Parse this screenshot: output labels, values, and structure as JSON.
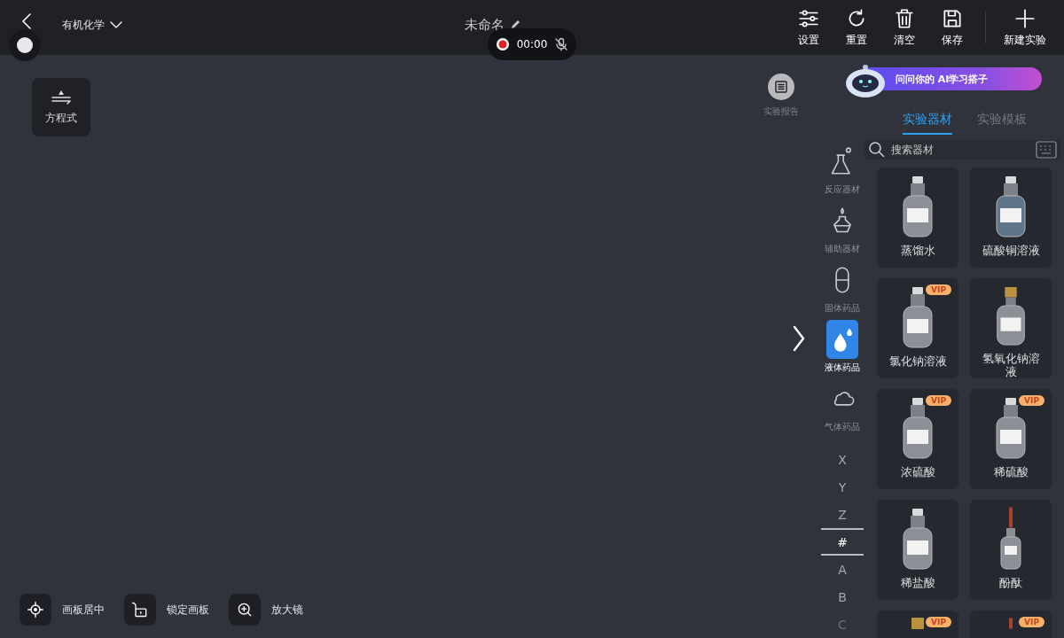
{
  "top_bar": {
    "subject": "有机化学",
    "title": "未命名",
    "recording": {
      "time": "00:00",
      "mic_muted": true
    },
    "tools": [
      {
        "kind": "settings",
        "label": "设置"
      },
      {
        "kind": "reset",
        "label": "重置"
      },
      {
        "kind": "clear",
        "label": "清空"
      },
      {
        "kind": "save",
        "label": "保存"
      },
      {
        "kind": "new",
        "label": "新建实验"
      }
    ]
  },
  "canvas": {
    "equation_button": "方程式",
    "report_button": "实验报告",
    "bottom_tools": [
      {
        "kind": "center",
        "label": "画板居中"
      },
      {
        "kind": "lock",
        "label": "锁定画板"
      },
      {
        "kind": "zoom",
        "label": "放大镜"
      }
    ]
  },
  "panel": {
    "banner": "问问你的 AI学习搭子",
    "tabs": [
      {
        "label": "实验器材",
        "selected": true
      },
      {
        "label": "实验模板",
        "selected": false
      }
    ],
    "search": {
      "placeholder": "搜索器材"
    },
    "categories": [
      {
        "kind": "flask",
        "label": "反应器材",
        "selected": false
      },
      {
        "kind": "burner",
        "label": "辅助器材",
        "selected": false
      },
      {
        "kind": "capsule",
        "label": "固体药品",
        "selected": false
      },
      {
        "kind": "drop",
        "label": "液体药品",
        "selected": true
      },
      {
        "kind": "cloud",
        "label": "气体药品",
        "selected": false
      }
    ],
    "index_letters": [
      {
        "label": "X",
        "selected": false
      },
      {
        "label": "Y",
        "selected": false
      },
      {
        "label": "Z",
        "selected": false
      },
      {
        "label": "#",
        "selected": true
      },
      {
        "label": "A",
        "selected": false
      },
      {
        "label": "B",
        "selected": false
      },
      {
        "label": "C",
        "selected": false
      }
    ],
    "items": [
      {
        "name": "蒸馏水",
        "kind": "clear"
      },
      {
        "name": "硫酸铜溶液",
        "kind": "blue"
      },
      {
        "name": "氯化钠溶液",
        "kind": "clear",
        "badge": "VIP"
      },
      {
        "name": "氢氧化钠溶液",
        "kind": "gold"
      },
      {
        "name": "浓硫酸",
        "kind": "clear",
        "badge": "VIP"
      },
      {
        "name": "稀硫酸",
        "kind": "clear",
        "badge": "VIP"
      },
      {
        "name": "稀盐酸",
        "kind": "clear"
      },
      {
        "name": "酚酞",
        "kind": "dropper"
      },
      {
        "kind": "gold",
        "badge": "VIP"
      },
      {
        "kind": "dropper",
        "badge": "VIP"
      }
    ]
  }
}
